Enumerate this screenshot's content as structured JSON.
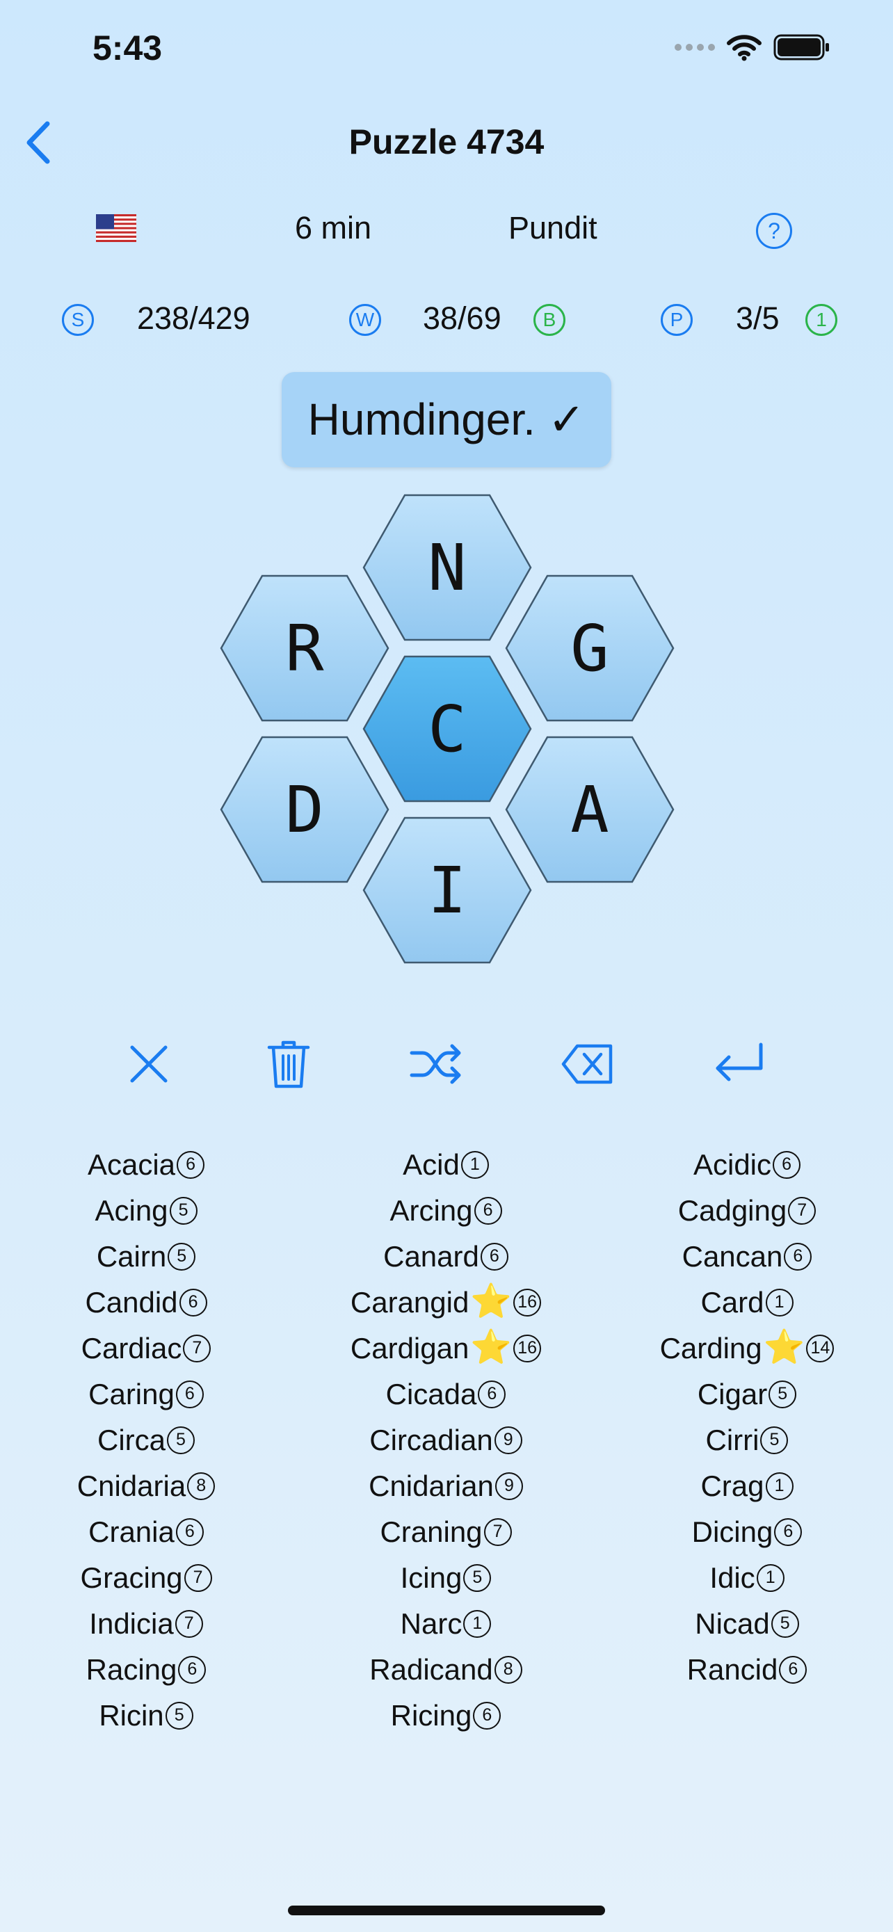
{
  "status_bar": {
    "time": "5:43"
  },
  "header": {
    "title": "Puzzle 4734"
  },
  "info": {
    "time": "6 min",
    "rank": "Pundit",
    "help_label": "?"
  },
  "stats": {
    "score_badge": "S",
    "score": "238/429",
    "words_badge": "W",
    "words": "38/69",
    "bonus_badge": "B",
    "pangrams_badge": "P",
    "pangrams": "3/5",
    "pangram_count_badge": "1"
  },
  "toast": {
    "message": "Humdinger. ✓"
  },
  "hive": {
    "center": "C",
    "outer": {
      "top": "N",
      "upper_left": "R",
      "upper_right": "G",
      "lower_left": "D",
      "lower_right": "A",
      "bottom": "I"
    }
  },
  "colors": {
    "accent": "#1a7cf0",
    "green": "#2bb44a",
    "center_hex": "#4aaeea",
    "outer_hex": "#a6d3f7"
  },
  "words": [
    [
      {
        "w": "Acacia",
        "n": "6",
        "star": ""
      },
      {
        "w": "Acing",
        "n": "5",
        "star": ""
      },
      {
        "w": "Cairn",
        "n": "5",
        "star": ""
      },
      {
        "w": "Candid",
        "n": "6",
        "star": ""
      },
      {
        "w": "Cardiac",
        "n": "7",
        "star": ""
      },
      {
        "w": "Caring",
        "n": "6",
        "star": ""
      },
      {
        "w": "Circa",
        "n": "5",
        "star": ""
      },
      {
        "w": "Cnidaria",
        "n": "8",
        "star": ""
      },
      {
        "w": "Crania",
        "n": "6",
        "star": ""
      },
      {
        "w": "Gracing",
        "n": "7",
        "star": ""
      },
      {
        "w": "Indicia",
        "n": "7",
        "star": ""
      },
      {
        "w": "Racing",
        "n": "6",
        "star": ""
      },
      {
        "w": "Ricin",
        "n": "5",
        "star": ""
      }
    ],
    [
      {
        "w": "Acid",
        "n": "1",
        "star": ""
      },
      {
        "w": "Arcing",
        "n": "6",
        "star": ""
      },
      {
        "w": "Canard",
        "n": "6",
        "star": ""
      },
      {
        "w": "Carangid",
        "n": "16",
        "star": "⭐"
      },
      {
        "w": "Cardigan",
        "n": "16",
        "star": "⭐"
      },
      {
        "w": "Cicada",
        "n": "6",
        "star": ""
      },
      {
        "w": "Circadian",
        "n": "9",
        "star": ""
      },
      {
        "w": "Cnidarian",
        "n": "9",
        "star": ""
      },
      {
        "w": "Craning",
        "n": "7",
        "star": ""
      },
      {
        "w": "Icing",
        "n": "5",
        "star": ""
      },
      {
        "w": "Narc",
        "n": "1",
        "star": ""
      },
      {
        "w": "Radicand",
        "n": "8",
        "star": ""
      },
      {
        "w": "Ricing",
        "n": "6",
        "star": ""
      }
    ],
    [
      {
        "w": "Acidic",
        "n": "6",
        "star": ""
      },
      {
        "w": "Cadging",
        "n": "7",
        "star": ""
      },
      {
        "w": "Cancan",
        "n": "6",
        "star": ""
      },
      {
        "w": "Card",
        "n": "1",
        "star": ""
      },
      {
        "w": "Carding",
        "n": "14",
        "star": "⭐"
      },
      {
        "w": "Cigar",
        "n": "5",
        "star": ""
      },
      {
        "w": "Cirri",
        "n": "5",
        "star": ""
      },
      {
        "w": "Crag",
        "n": "1",
        "star": ""
      },
      {
        "w": "Dicing",
        "n": "6",
        "star": ""
      },
      {
        "w": "Idic",
        "n": "1",
        "star": ""
      },
      {
        "w": "Nicad",
        "n": "5",
        "star": ""
      },
      {
        "w": "Rancid",
        "n": "6",
        "star": ""
      }
    ]
  ]
}
